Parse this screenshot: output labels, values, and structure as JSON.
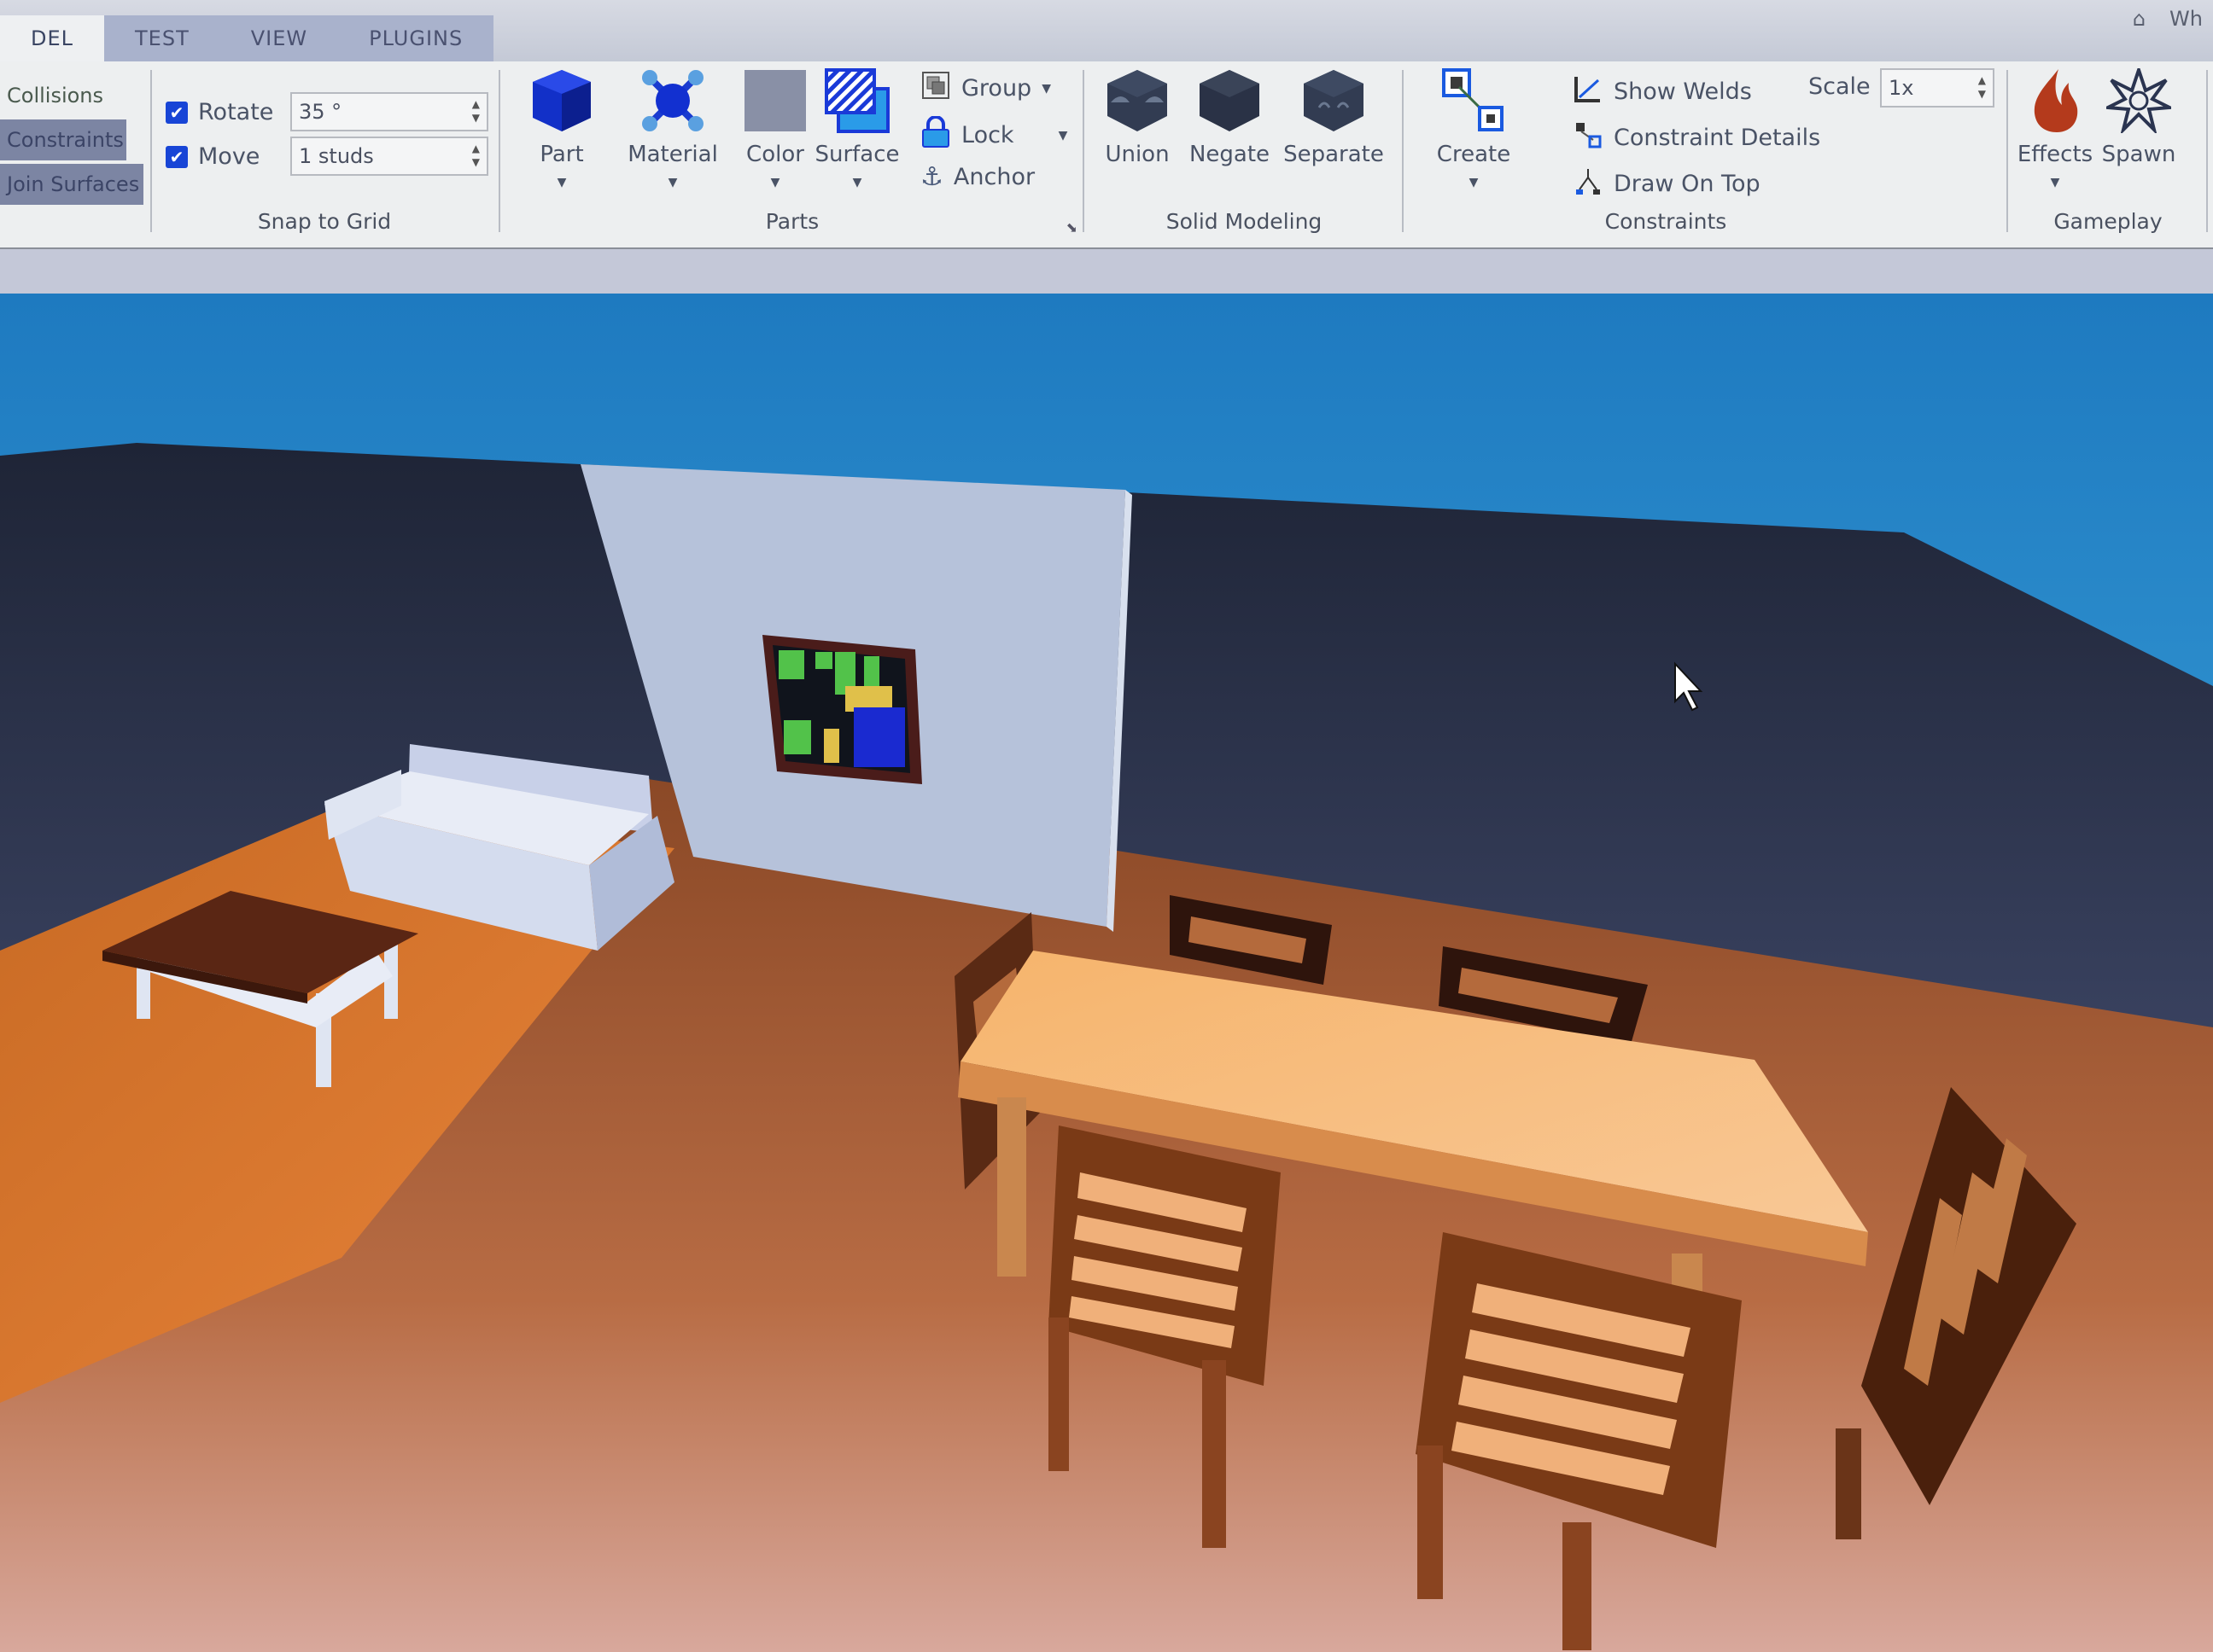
{
  "tabs": [
    {
      "label": "DEL",
      "active": true
    },
    {
      "label": "TEST"
    },
    {
      "label": "VIEW"
    },
    {
      "label": "PLUGINS"
    }
  ],
  "top_right": {
    "label": "Wh"
  },
  "left_panel": {
    "collisions": "Collisions",
    "constraints": "Constraints",
    "join_surfaces": "Join Surfaces"
  },
  "snap_to_grid": {
    "rotate_label": "Rotate",
    "rotate_checked": true,
    "rotate_value": "35 °",
    "move_label": "Move",
    "move_checked": true,
    "move_value": "1 studs",
    "group_label": "Snap to Grid"
  },
  "parts": {
    "part": "Part",
    "material": "Material",
    "color": "Color",
    "surface": "Surface",
    "group": "Group",
    "lock": "Lock",
    "anchor": "Anchor",
    "group_label": "Parts"
  },
  "solid_modeling": {
    "union": "Union",
    "negate": "Negate",
    "separate": "Separate",
    "group_label": "Solid Modeling"
  },
  "constraints": {
    "create": "Create",
    "show_welds": "Show Welds",
    "constraint_details": "Constraint Details",
    "draw_on_top": "Draw On Top",
    "scale_label": "Scale",
    "scale_value": "1x",
    "group_label": "Constraints"
  },
  "gameplay": {
    "effects": "Effects",
    "spawn": "Spawn",
    "group_label": "Gameplay"
  },
  "colors": {
    "checkbox_blue": "#1845d6",
    "sky_blue": "#2f8fd0",
    "floor_orange": "#c8773a",
    "wall_light": "#b9c4dc",
    "table_top": "#f0a860",
    "chair_brown": "#6a3418"
  }
}
